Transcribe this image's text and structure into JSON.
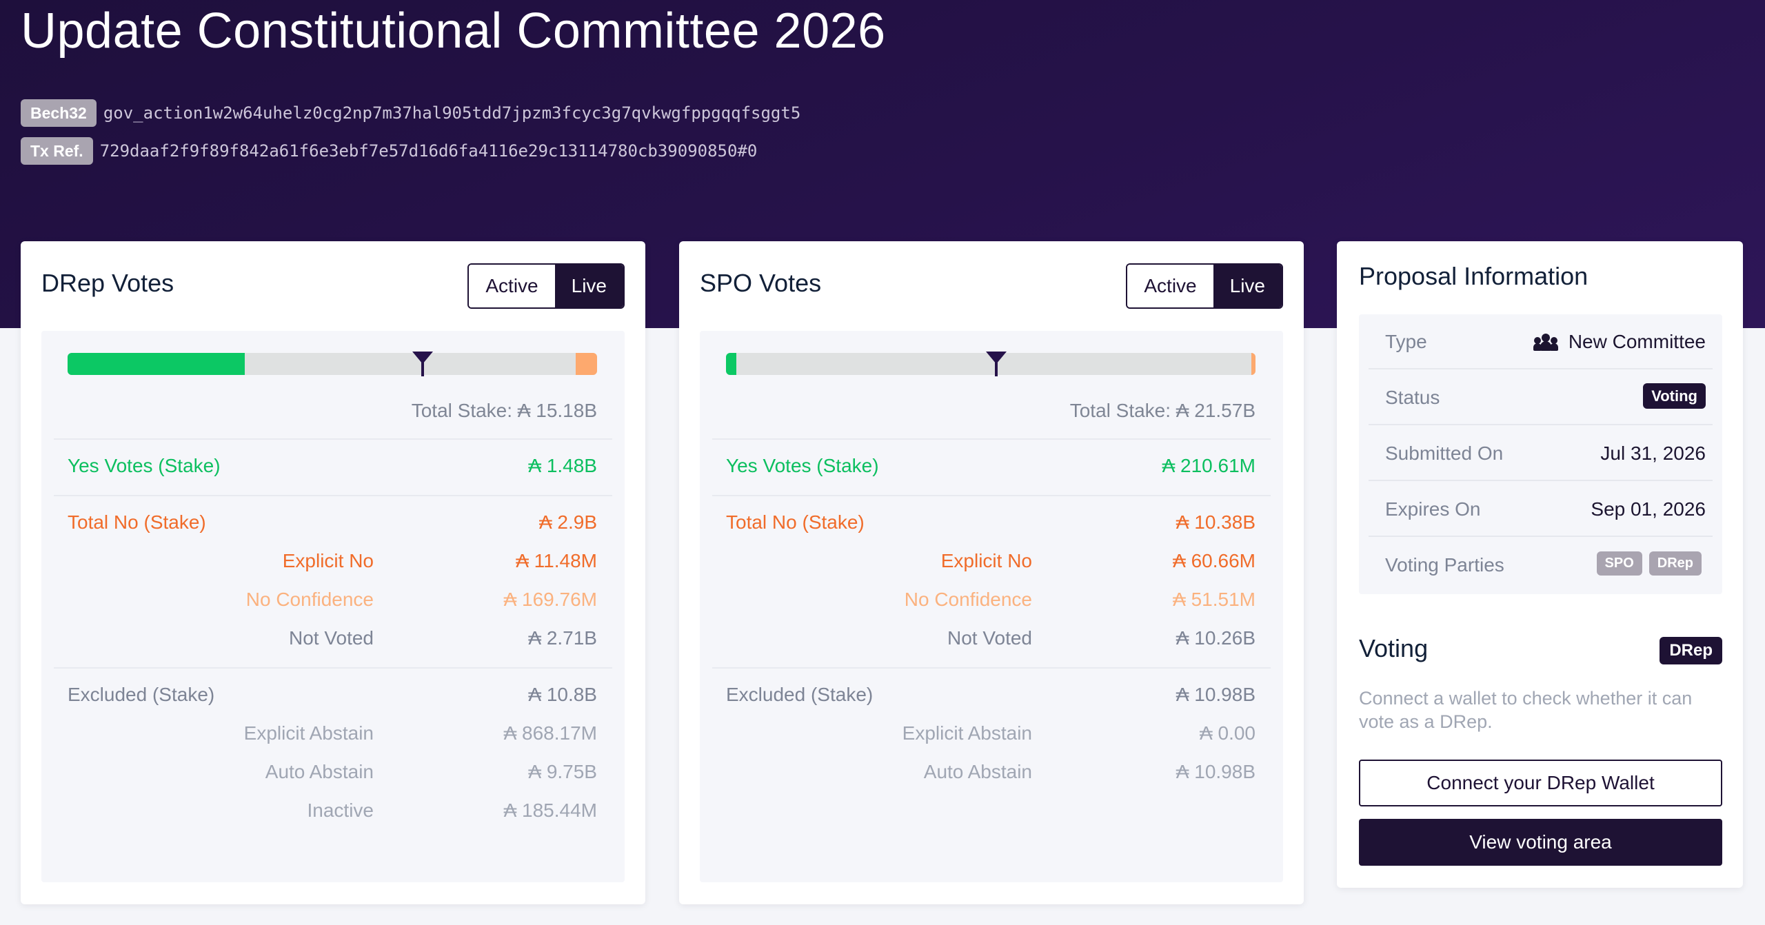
{
  "page": {
    "title": "Update Constitutional Committee 2026",
    "bech32_label": "Bech32",
    "bech32_value": "gov_action1w2w64uhelz0cg2np7m37hal905tdd7jpzm3fcyc3g7qvkwgfppgqqfsggt5",
    "txref_label": "Tx Ref.",
    "txref_value": "729daaf2f9f89f842a61f6e3ebf7e57d16d6fa4116e29c13114780cb39090850#0"
  },
  "colors": {
    "hero_bg": "#26124a",
    "yes": "#0cc864",
    "no": "#f06c2a",
    "no_confidence": "#fbb27f",
    "dark": "#1e1234"
  },
  "drep": {
    "title": "DRep Votes",
    "toggle_active": "Active",
    "toggle_live": "Live",
    "bar": {
      "yes_fraction": 0.335,
      "no_fraction": 0.04,
      "threshold_fraction": 0.67
    },
    "total_stake": "Total Stake: ₳ 15.18B",
    "yes_label": "Yes Votes (Stake)",
    "yes_value": "₳ 1.48B",
    "no_label": "Total No (Stake)",
    "no_value": "₳ 2.9B",
    "explicit_no_label": "Explicit No",
    "explicit_no_value": "₳ 11.48M",
    "no_conf_label": "No Confidence",
    "no_conf_value": "₳ 169.76M",
    "not_voted_label": "Not Voted",
    "not_voted_value": "₳ 2.71B",
    "excluded_label": "Excluded (Stake)",
    "excluded_value": "₳ 10.8B",
    "explicit_abstain_label": "Explicit Abstain",
    "explicit_abstain_value": "₳ 868.17M",
    "auto_abstain_label": "Auto Abstain",
    "auto_abstain_value": "₳ 9.75B",
    "inactive_label": "Inactive",
    "inactive_value": "₳ 185.44M"
  },
  "spo": {
    "title": "SPO Votes",
    "toggle_active": "Active",
    "toggle_live": "Live",
    "bar": {
      "yes_fraction": 0.02,
      "no_fraction": 0.008,
      "threshold_fraction": 0.51
    },
    "total_stake": "Total Stake: ₳ 21.57B",
    "yes_label": "Yes Votes (Stake)",
    "yes_value": "₳ 210.61M",
    "no_label": "Total No (Stake)",
    "no_value": "₳ 10.38B",
    "explicit_no_label": "Explicit No",
    "explicit_no_value": "₳ 60.66M",
    "no_conf_label": "No Confidence",
    "no_conf_value": "₳ 51.51M",
    "not_voted_label": "Not Voted",
    "not_voted_value": "₳ 10.26B",
    "excluded_label": "Excluded (Stake)",
    "excluded_value": "₳ 10.98B",
    "explicit_abstain_label": "Explicit Abstain",
    "explicit_abstain_value": "₳ 0.00",
    "auto_abstain_label": "Auto Abstain",
    "auto_abstain_value": "₳ 10.98B"
  },
  "info": {
    "title": "Proposal Information",
    "type_label": "Type",
    "type_value": "New Committee",
    "type_icon": "people-icon",
    "status_label": "Status",
    "status_value": "Voting",
    "submitted_label": "Submitted On",
    "submitted_value": "Jul 31, 2026",
    "expires_label": "Expires On",
    "expires_value": "Sep 01, 2026",
    "parties_label": "Voting Parties",
    "party_1": "SPO",
    "party_2": "DRep"
  },
  "voting": {
    "title": "Voting",
    "badge": "DRep",
    "description": "Connect a wallet to check whether it can vote as a DRep.",
    "connect_button": "Connect your DRep Wallet",
    "view_button": "View voting area"
  }
}
